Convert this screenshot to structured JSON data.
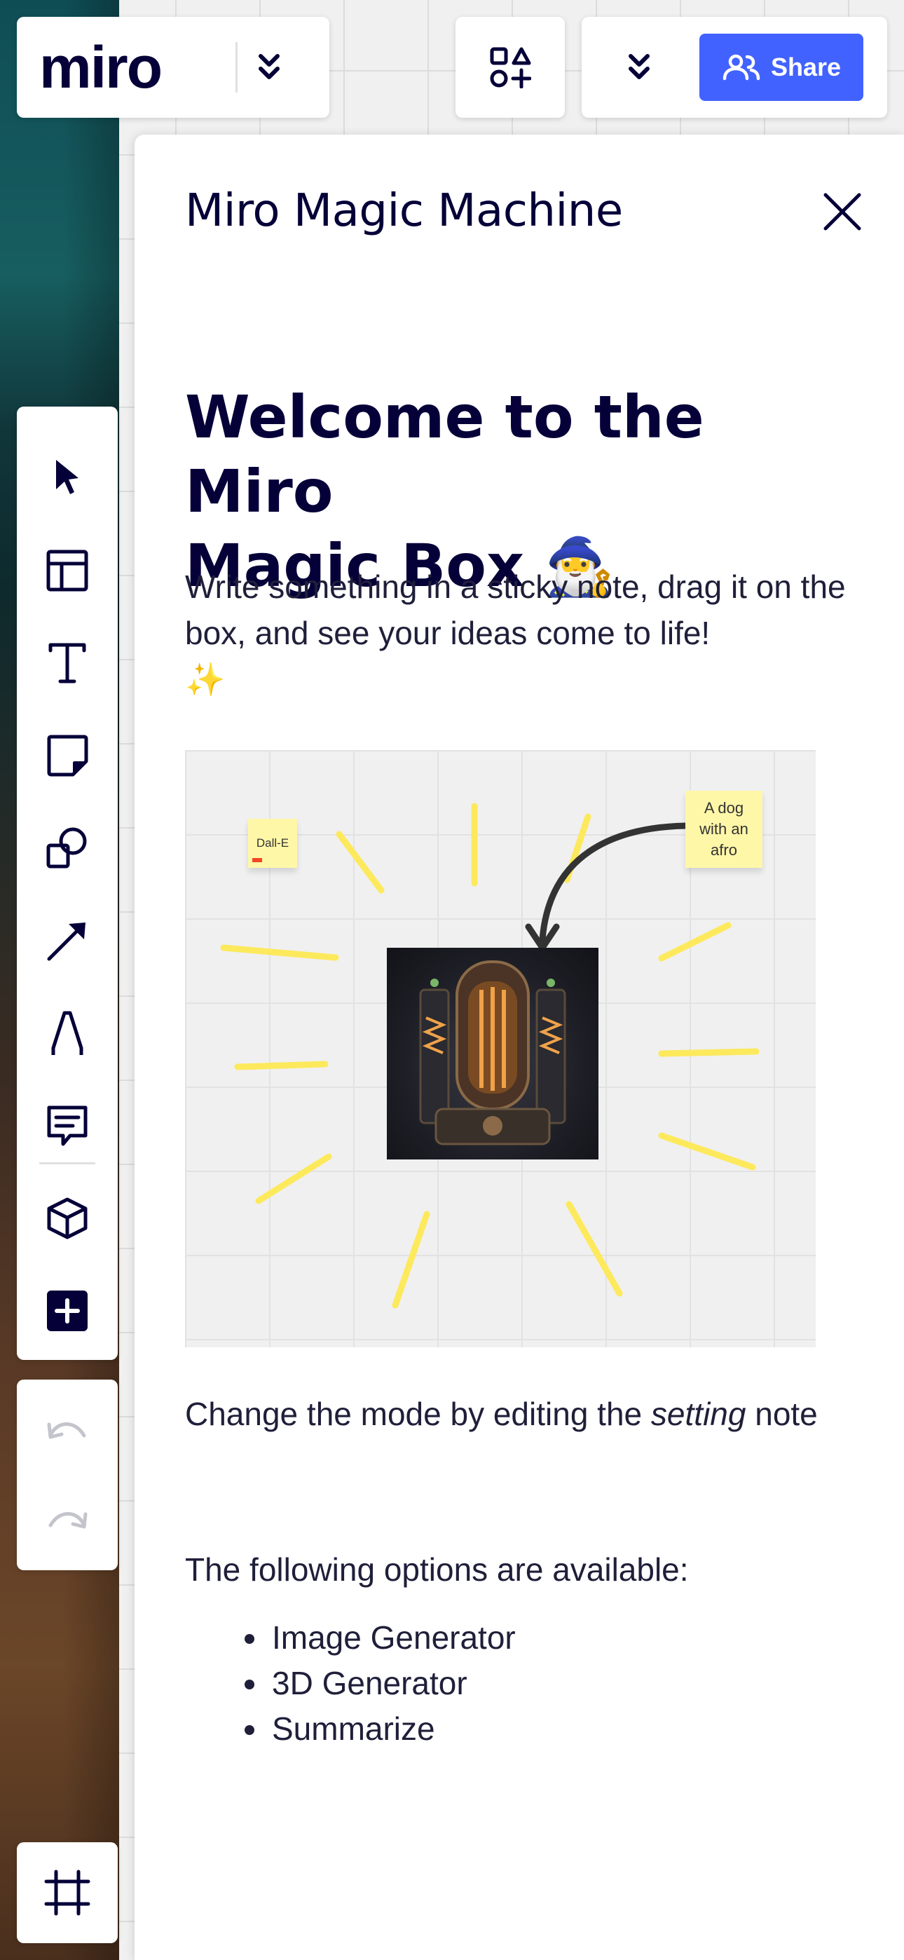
{
  "topbar": {
    "logo": "miro",
    "share_label": "Share"
  },
  "toolbar": {
    "tools": [
      "select-tool",
      "templates-tool",
      "text-tool",
      "sticky-note-tool",
      "shapes-tool",
      "connection-line-tool",
      "pen-tool",
      "comment-tool",
      "apps-3d-tool",
      "more-tools"
    ],
    "undo_icon": "undo-icon",
    "redo_icon": "redo-icon",
    "frames_icon": "frames-icon"
  },
  "panel": {
    "title": "Miro Magic Machine",
    "welcome_line1": "Welcome to the Miro",
    "welcome_line2": "Magic Box",
    "welcome_emoji": "🧙‍♂️",
    "intro": "Write something in a sticky note, drag it on the box, and see your ideas come to life!",
    "intro_emoji": "✨",
    "illustration": {
      "sticky_left": "Dall-E",
      "sticky_right_line1": "A dog",
      "sticky_right_line2": "with an",
      "sticky_right_line3": "afro"
    },
    "mode_before": "Change the mode by editing the ",
    "mode_em": "setting",
    "mode_after": " note",
    "options_intro": "The following options are available:",
    "options": [
      "Image Generator",
      "3D Generator",
      "Summarize"
    ]
  },
  "colors": {
    "accent": "#4262ff",
    "text": "#050038",
    "sticky": "#fff7a8",
    "rays": "#fde95c"
  }
}
